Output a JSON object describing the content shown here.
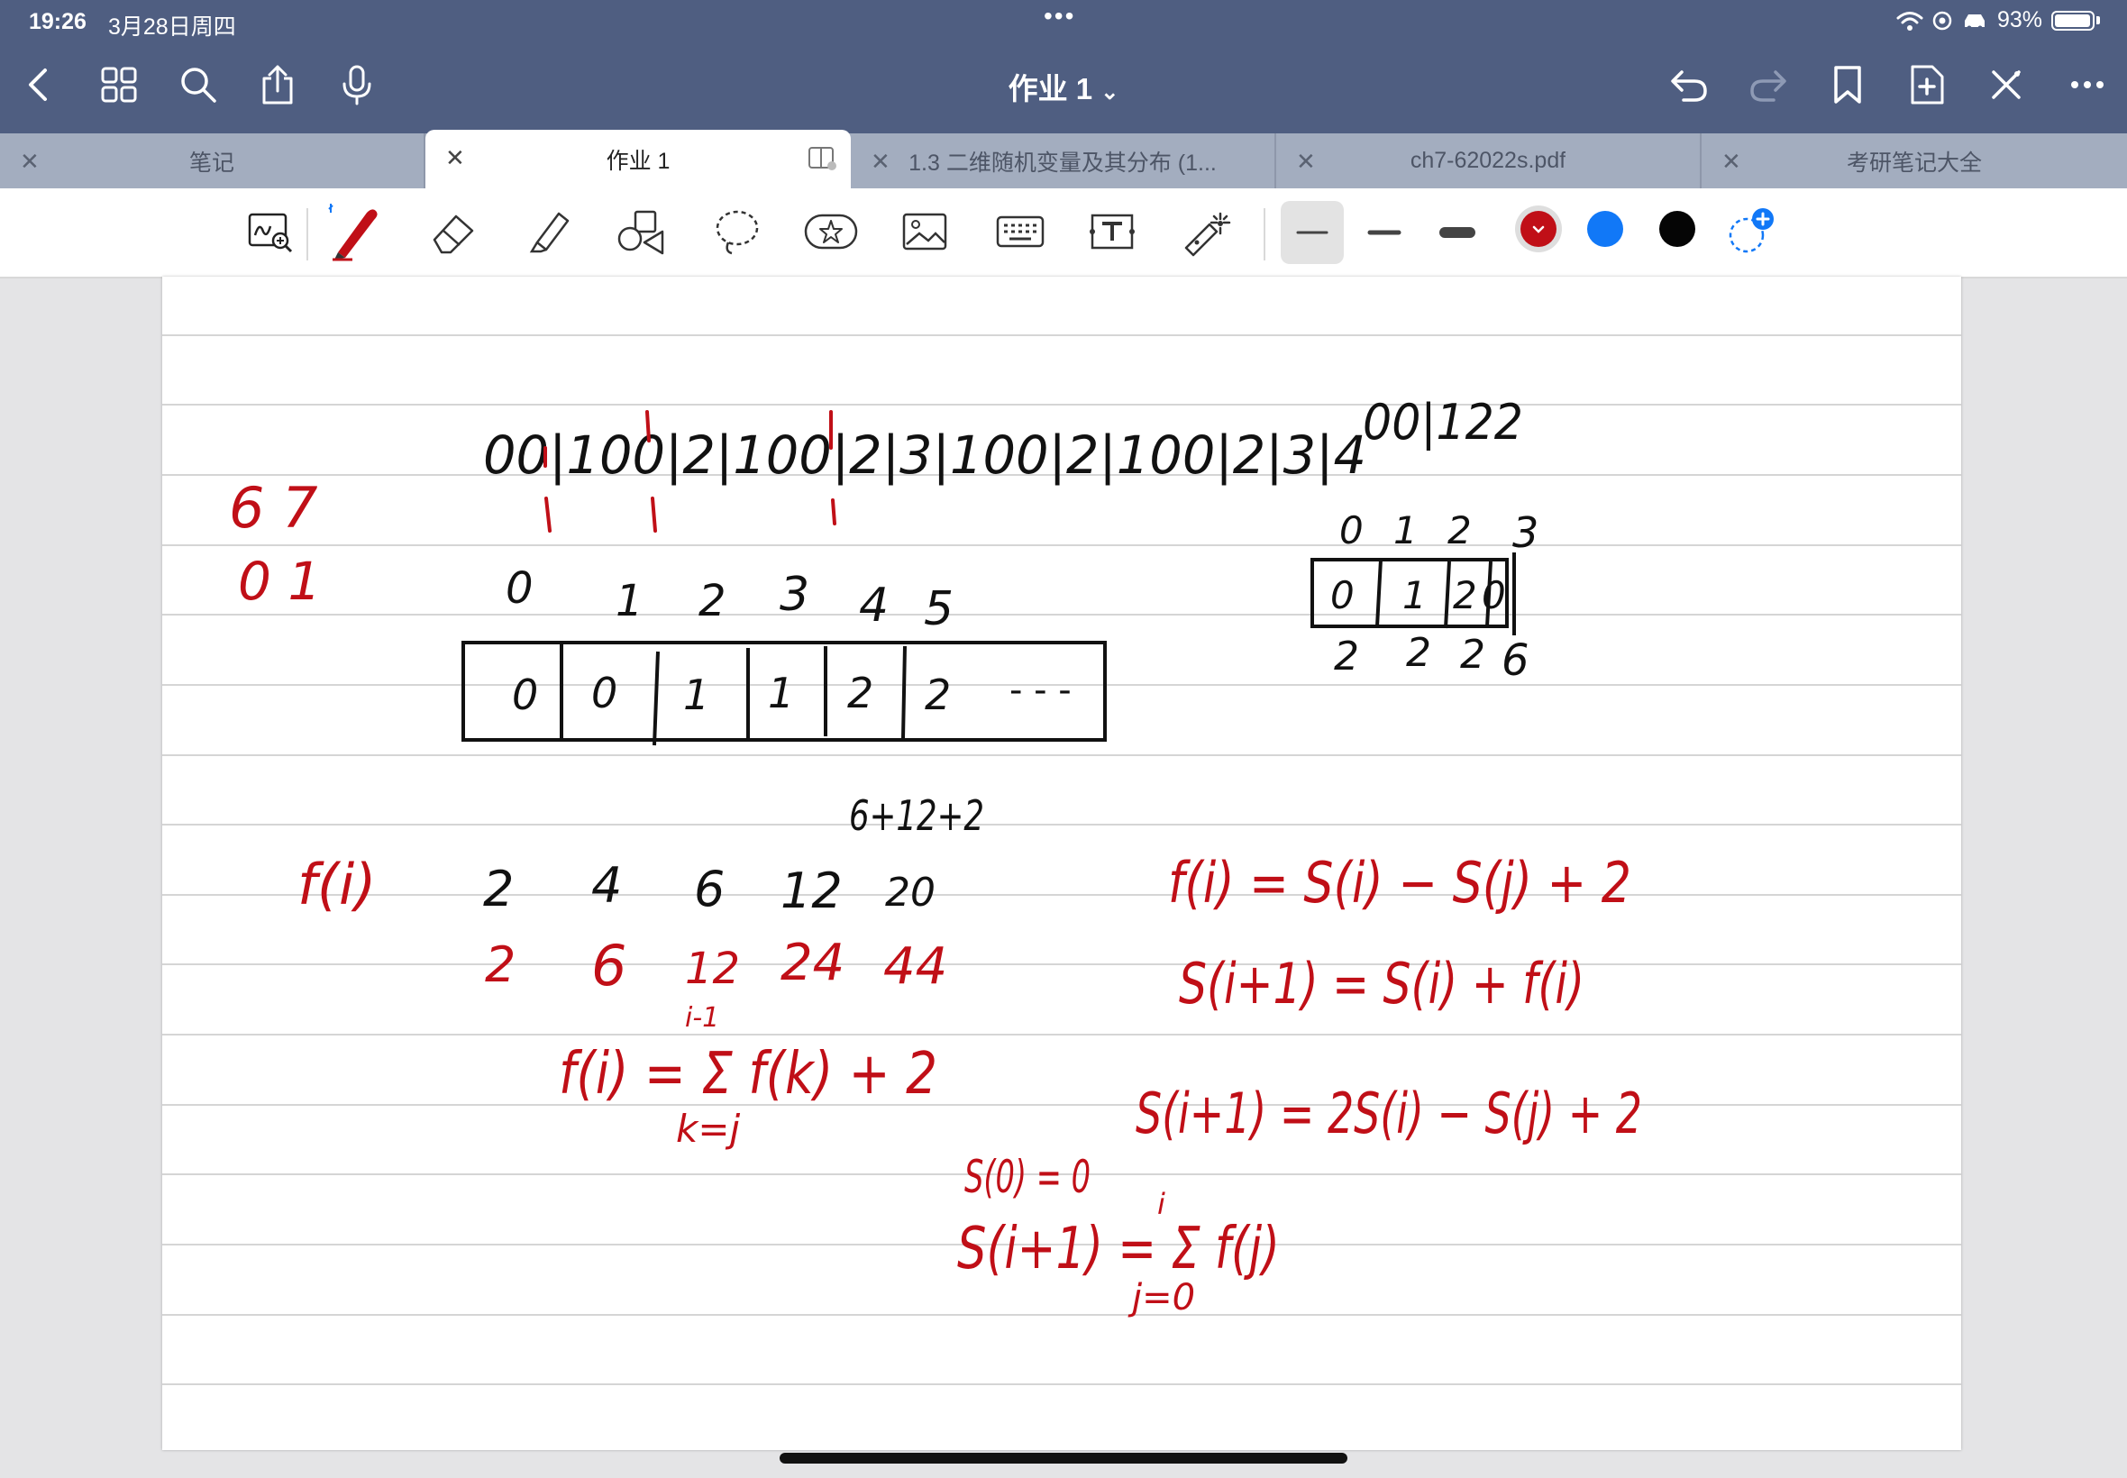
{
  "status_bar": {
    "time": "19:26",
    "date": "3月28日周四",
    "battery": "93%",
    "dots": "•••"
  },
  "header": {
    "title": "作业 1",
    "title_chevron": "⌄"
  },
  "icons": {
    "back": "chevron-left-icon",
    "grid": "grid-icon",
    "search": "search-icon",
    "share": "share-icon",
    "mic": "microphone-icon",
    "undo": "undo-icon",
    "redo": "redo-icon",
    "bookmark": "bookmark-icon",
    "add_page": "add-page-icon",
    "close_edit": "close-icon",
    "more": "more-icon"
  },
  "tabs": [
    {
      "label": "笔记",
      "active": false
    },
    {
      "label": "作业 1",
      "active": true
    },
    {
      "label": "1.3 二维随机变量及其分布 (1...",
      "active": false
    },
    {
      "label": "ch7-62022s.pdf",
      "active": false
    },
    {
      "label": "考研笔记大全",
      "active": false
    }
  ],
  "toolbar": {
    "tools": [
      "zoom-handwriting-icon",
      "pen-icon",
      "eraser-icon",
      "highlighter-icon",
      "shapes-icon",
      "lasso-icon",
      "sticker-icon",
      "image-icon",
      "keyboard-icon",
      "text-box-icon",
      "laser-pointer-icon"
    ],
    "stroke_widths": [
      "thin",
      "medium",
      "thick"
    ],
    "colors": [
      "#c00f17",
      "#1178f7",
      "#050505"
    ],
    "selected_color": "#c00f17"
  },
  "handwriting": {
    "sequence": "00|100|2|100|2|3|100|2|100|2|3|4",
    "sequence_right": "00|122",
    "box_indices": [
      "0",
      "1",
      "2",
      "3",
      "4",
      "5"
    ],
    "box_cells": [
      "0",
      "0",
      "1",
      "1",
      "2",
      "2",
      "- - -"
    ],
    "small_box_indices": [
      "0",
      "1",
      "2",
      "3"
    ],
    "small_box_cells": [
      "0",
      "1",
      "2",
      "0"
    ],
    "small_box_below": [
      "2",
      "2",
      "2",
      "6"
    ],
    "left_red_top": "6 7",
    "left_red_bottom": "0 1",
    "sum_note": "6+12+2",
    "f_label": "f(i)",
    "f_values": [
      "2",
      "4",
      "6",
      "12",
      "20"
    ],
    "s_values": [
      "2",
      "6",
      "12",
      "24",
      "44"
    ],
    "eq_sum": "f(i) = Σ f(k) + 2",
    "eq_sum_upper": "i-1",
    "eq_sum_lower": "k=j",
    "eq_1": "f(i) = S(i) − S(j) + 2",
    "eq_2": "S(i+1) = S(i) + f(i)",
    "eq_3": "S(i+1) = 2S(i) − S(j) + 2",
    "eq_s0": "S(0) = 0",
    "eq_s": "S(i+1) = Σ f(j)",
    "eq_s_upper": "i",
    "eq_s_lower": "j=0"
  }
}
